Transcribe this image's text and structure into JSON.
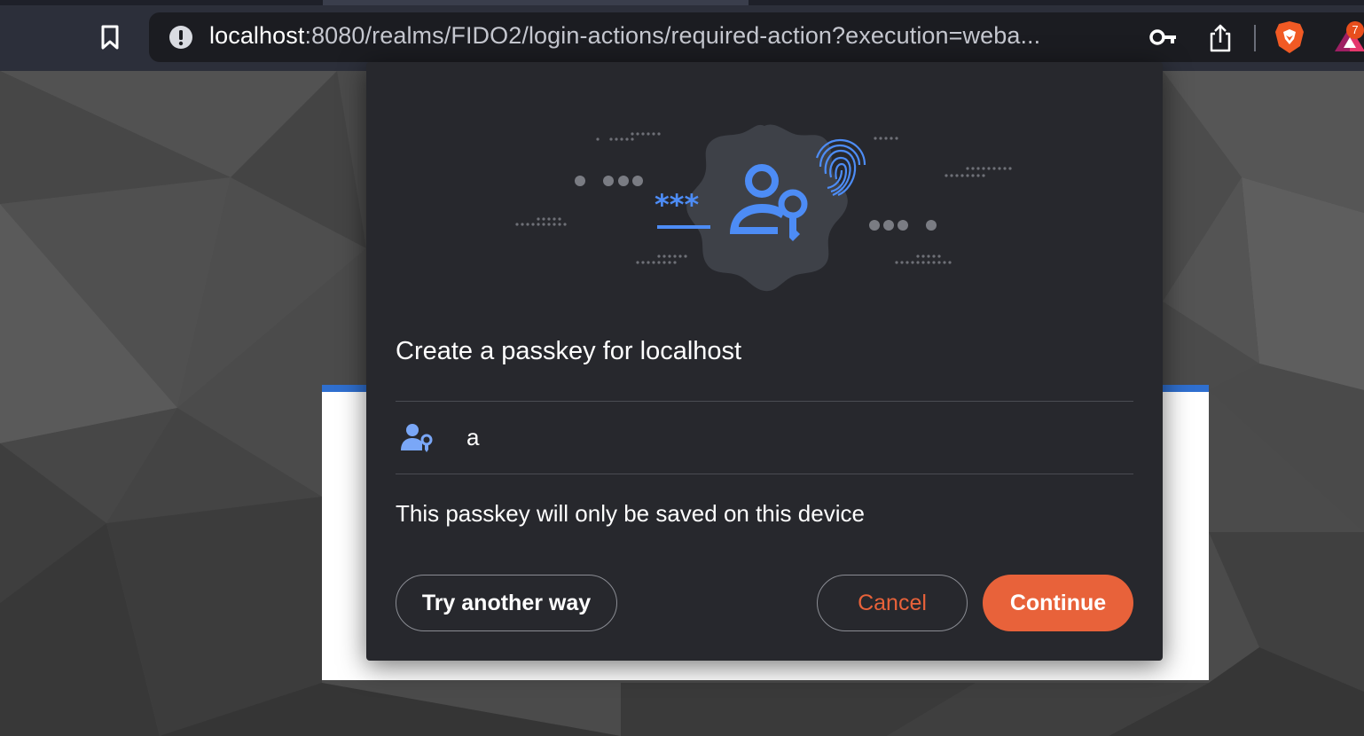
{
  "browser": {
    "url_host": "localhost",
    "url_rest": ":8080/realms/FIDO2/login-actions/required-action?execution=weba...",
    "rewards_badge": "7",
    "colors": {
      "toolbar": "#2c2f3a",
      "urlbar": "#1b1c21"
    },
    "icons": [
      "bookmark-icon",
      "site-info-warning-icon",
      "key-icon",
      "share-icon",
      "brave-shield-icon",
      "brave-rewards-icon"
    ]
  },
  "dialog": {
    "title": "Create a passkey for localhost",
    "account_name": "a",
    "info": "This passkey will only be saved on this device",
    "buttons": {
      "try_another": "Try another way",
      "cancel": "Cancel",
      "continue": "Continue"
    },
    "hero_password_mask": "***",
    "colors": {
      "background": "#27282d",
      "accent": "#e8623a",
      "icon_blue": "#4d8cf5"
    }
  },
  "page": {
    "card_accent": "#2f6fcf"
  }
}
